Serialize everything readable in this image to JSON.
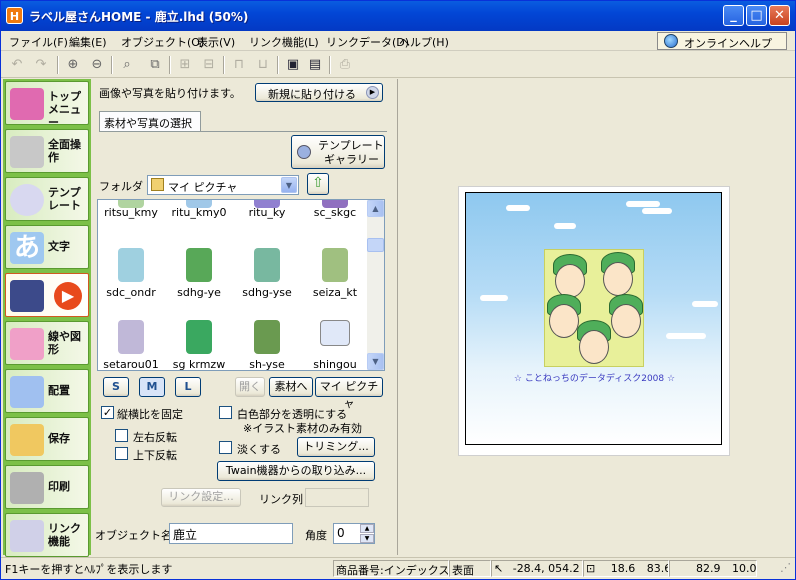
{
  "window": {
    "title": "ラベル屋さんHOME - 鹿立.lhd (50%)"
  },
  "menu": [
    "ファイル(F)",
    "編集(E)",
    "オブジェクト(O)",
    "表示(V)",
    "リンク機能(L)",
    "リンクデータ(D)",
    "ヘルプ(H)"
  ],
  "online_help": "オンラインヘルプ",
  "sidebar": [
    {
      "label": "トップメニュー",
      "icon": "home-icon",
      "color": "#e06ab0"
    },
    {
      "label": "全面操作",
      "icon": "full-edit-icon",
      "color": "#c8c8c8"
    },
    {
      "label": "テンプレート",
      "icon": "template-disc-icon",
      "color": "#d8d8f0"
    },
    {
      "label": "文字",
      "icon": "text-a-icon",
      "color": "#9fc8f0"
    },
    {
      "label": "",
      "icon": "image-palette-icon",
      "color": "#e84a1c"
    },
    {
      "label": "線や図形",
      "icon": "shapes-icon",
      "color": "#f0a0c8"
    },
    {
      "label": "配置",
      "icon": "layout-icon",
      "color": "#a0c0f0"
    },
    {
      "label": "保存",
      "icon": "folder-icon",
      "color": "#f0c860"
    },
    {
      "label": "印刷",
      "icon": "printer-icon",
      "color": "#b0b0b0"
    },
    {
      "label": "リンク機能",
      "icon": "link-icon",
      "color": "#d0d0e8"
    }
  ],
  "panel": {
    "hint": "画像や写真を貼り付けます。",
    "new_paste": "新規に貼り付ける",
    "tab": "素材や写真の選択",
    "template_gallery": [
      "テンプレート",
      "ギャラリー"
    ],
    "folder_label": "フォルダ",
    "folder_value": "マイ ピクチャ",
    "files": [
      "ritsu_kmy",
      "ritu_kmy0",
      "ritu_ky",
      "sc_skgc",
      "sdc_ondr",
      "sdhg-ye",
      "sdhg-yse",
      "seiza_kt",
      "setarou01",
      "sg krmzw",
      "sh-yse",
      "shingou"
    ],
    "size_buttons": [
      "S",
      "M",
      "L"
    ],
    "open_btn": "開く",
    "to_material": "素材へ",
    "my_picture": "マイ ピクチャ",
    "keep_ratio": "縦横比を固定",
    "flip_h": "左右反転",
    "flip_v": "上下反転",
    "white_transparent": "白色部分を透明にする",
    "illustration_note": "※イラスト素材のみ有効",
    "pale": "淡くする",
    "trimming": "トリミング...",
    "twain": "Twain機器からの取り込み...",
    "link_settings": "リンク設定...",
    "link_column": "リンク列",
    "object_name_label": "オブジェクト名",
    "object_name": "鹿立",
    "angle_label": "角度",
    "angle_value": "0"
  },
  "canvas": {
    "caption": "☆ ことねっちのデータディスク2008 ☆"
  },
  "status": {
    "help": "F1キーを押すとﾍﾙﾌﾟを表示します",
    "product": "商品番号:インデックスカ",
    "side": "表面",
    "pos": "-28.4, 054.2",
    "w": "18.6",
    "h": "83.6",
    "x2": "82.9",
    "y2": "10.0"
  }
}
